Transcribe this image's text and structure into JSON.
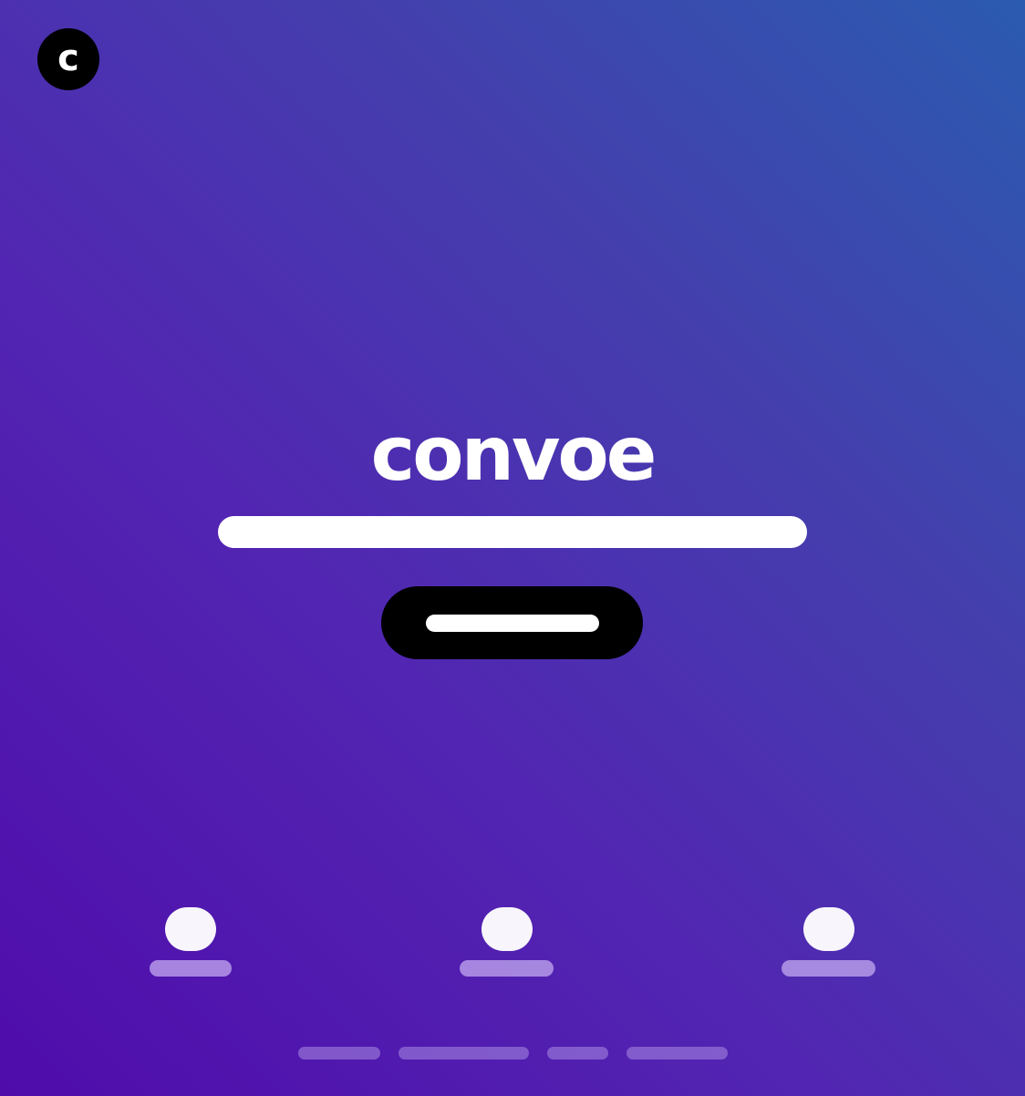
{
  "brand": {
    "logo_letter": "c",
    "wordmark": "convoe",
    "logo_badge_color": "#000000",
    "text_color": "#ffffff"
  },
  "hero": {
    "headline_placeholder": "",
    "cta_button_color": "#000000"
  },
  "features": [
    {
      "icon": "feature-icon-1"
    },
    {
      "icon": "feature-icon-2"
    },
    {
      "icon": "feature-icon-3"
    }
  ],
  "footer": {
    "link_count_visible": 4
  },
  "theme": {
    "gradient_colors": [
      "#2b5bb0",
      "#4340ad",
      "#5225b2",
      "#4f0cab"
    ],
    "accent": "#ffffff"
  }
}
